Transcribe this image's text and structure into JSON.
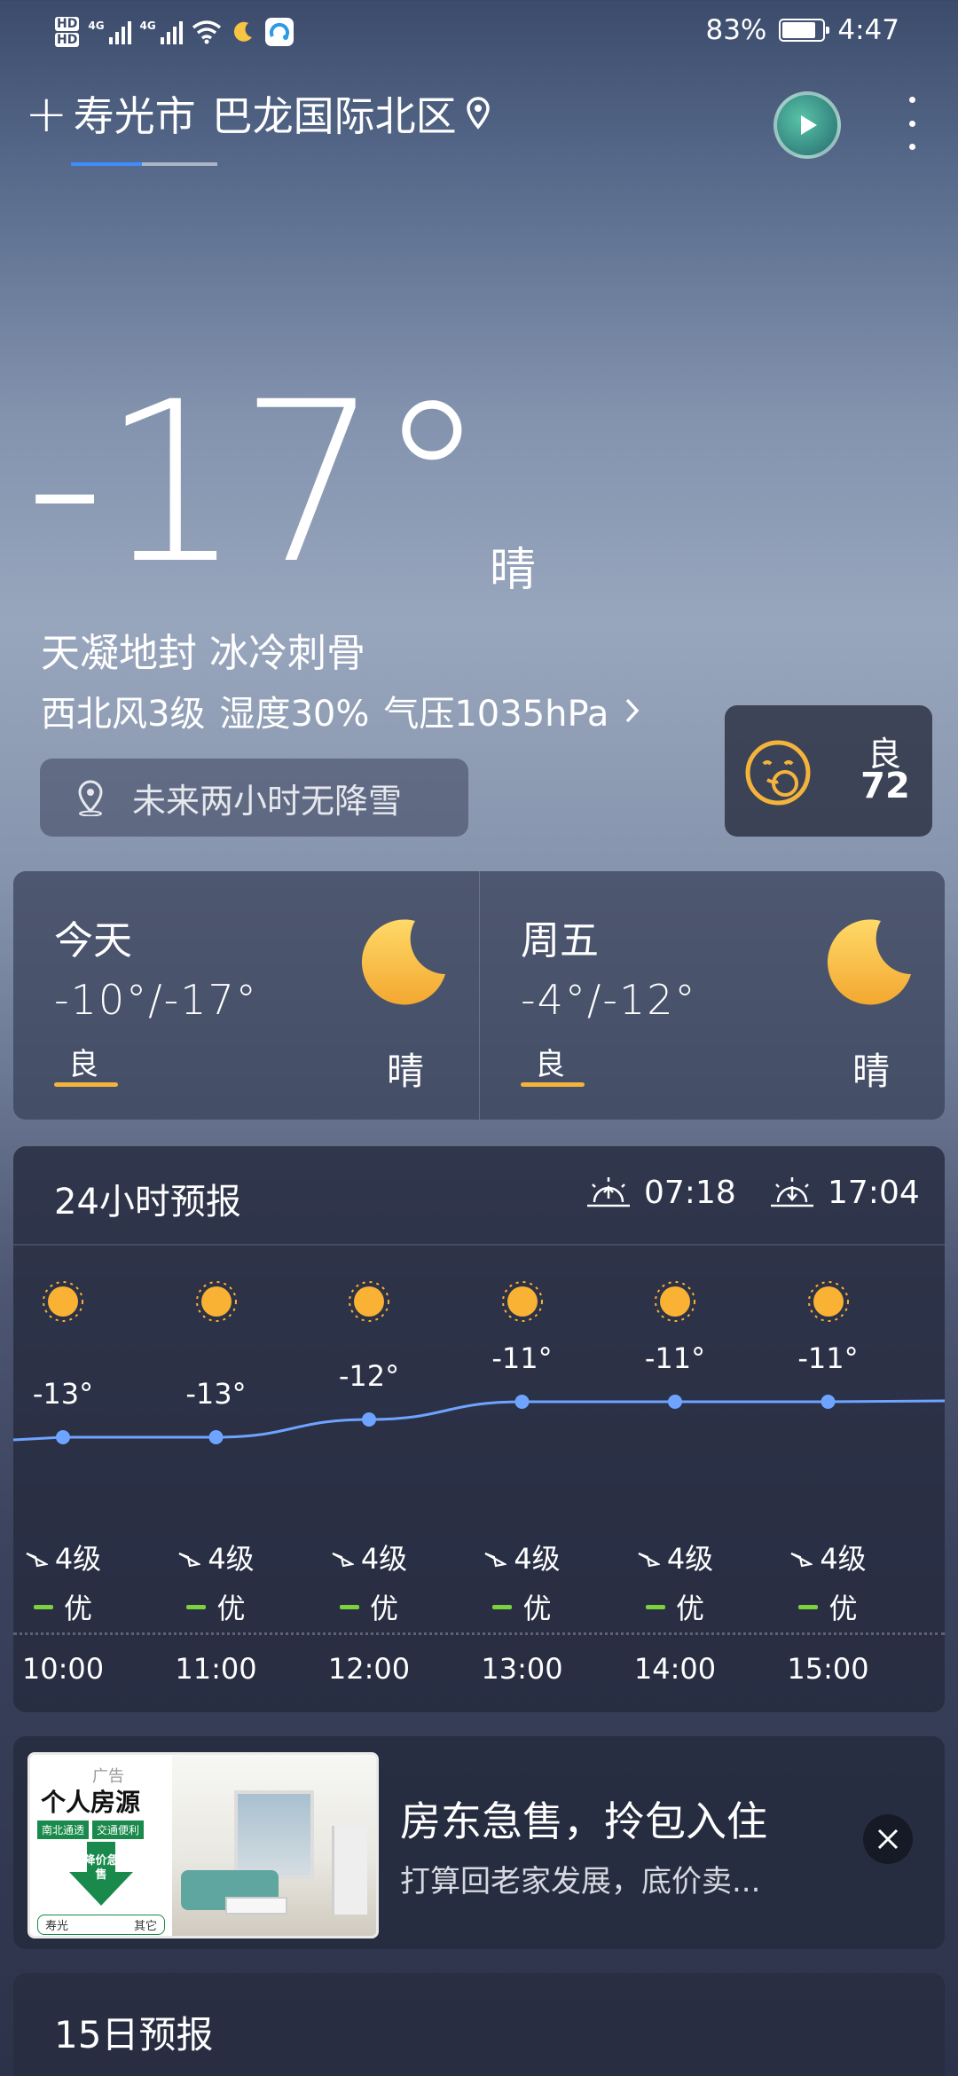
{
  "status_bar": {
    "hd1": "HD",
    "hd2": "HD",
    "net1": "4G",
    "net2": "4G",
    "battery": "83%",
    "battery_level": 0.83,
    "time": "4:47"
  },
  "header": {
    "city": "寿光市",
    "district": "巴龙国际北区"
  },
  "current": {
    "temperature": "-17°",
    "temperature_value": -17,
    "condition": "晴",
    "description": "天凝地封 冰冷刺骨",
    "wind": "西北风3级",
    "humidity": "湿度30%",
    "pressure": "气压1035hPa",
    "precip_notice": "未来两小时无降雪"
  },
  "aqi": {
    "label": "良",
    "value": "72"
  },
  "days": [
    {
      "name": "今天",
      "range": "-10°/-17°",
      "aq": "良",
      "sky": "晴"
    },
    {
      "name": "周五",
      "range": "-4°/-12°",
      "aq": "良",
      "sky": "晴"
    }
  ],
  "hourly": {
    "title": "24小时预报",
    "sunrise": "07:18",
    "sunset": "17:04",
    "items": [
      {
        "time": "10:00",
        "temp": "-13°",
        "temp_value": -13,
        "wind": "4级",
        "aq": "优"
      },
      {
        "time": "11:00",
        "temp": "-13°",
        "temp_value": -13,
        "wind": "4级",
        "aq": "优"
      },
      {
        "time": "12:00",
        "temp": "-12°",
        "temp_value": -12,
        "wind": "4级",
        "aq": "优"
      },
      {
        "time": "13:00",
        "temp": "-11°",
        "temp_value": -11,
        "wind": "4级",
        "aq": "优"
      },
      {
        "time": "14:00",
        "temp": "-11°",
        "temp_value": -11,
        "wind": "4级",
        "aq": "优"
      },
      {
        "time": "15:00",
        "temp": "-11°",
        "temp_value": -11,
        "wind": "4级",
        "aq": "优"
      }
    ]
  },
  "ad": {
    "badge": "广告",
    "brand": "个人房源",
    "tag1": "南北通透",
    "tag2": "交通便利",
    "promo": "降价急售",
    "foot_city": "寿光",
    "foot_other": "其它",
    "title": "房东急售，拎包入住",
    "subtitle": "打算回老家发展，底价卖..."
  },
  "fifteen_day": {
    "title": "15日预报"
  },
  "colors": {
    "accent_blue": "#3f8cff",
    "aq_good": "#f4b43b",
    "aq_excellent": "#7bd23a",
    "sun": "#f9b233",
    "curve": "#6ea4ff"
  }
}
